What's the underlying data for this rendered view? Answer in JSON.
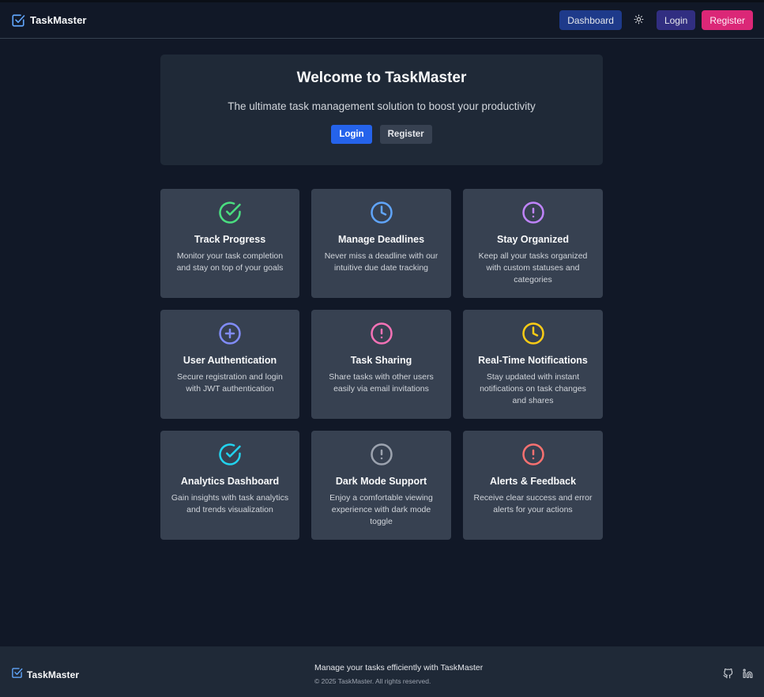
{
  "navbar": {
    "brand": "TaskMaster",
    "dashboard_label": "Dashboard",
    "login_label": "Login",
    "register_label": "Register",
    "theme_icon": "sun-icon"
  },
  "hero": {
    "title": "Welcome to TaskMaster",
    "subtitle": "The ultimate task management solution to boost your productivity",
    "login_label": "Login",
    "register_label": "Register"
  },
  "features": [
    {
      "title": "Track Progress",
      "description": "Monitor your task completion and stay on top of your goals",
      "icon": "check-circle-icon",
      "color": "#4ade80"
    },
    {
      "title": "Manage Deadlines",
      "description": "Never miss a deadline with our intuitive due date tracking",
      "icon": "clock-icon",
      "color": "#60a5fa"
    },
    {
      "title": "Stay Organized",
      "description": "Keep all your tasks organized with custom statuses and categories",
      "icon": "alert-circle-icon",
      "color": "#c084fc"
    },
    {
      "title": "User Authentication",
      "description": "Secure registration and login with JWT authentication",
      "icon": "plus-circle-icon",
      "color": "#818cf8"
    },
    {
      "title": "Task Sharing",
      "description": "Share tasks with other users easily via email invitations",
      "icon": "alert-circle-icon",
      "color": "#f472b6"
    },
    {
      "title": "Real-Time Notifications",
      "description": "Stay updated with instant notifications on task changes and shares",
      "icon": "clock-icon",
      "color": "#facc15"
    },
    {
      "title": "Analytics Dashboard",
      "description": "Gain insights with task analytics and trends visualization",
      "icon": "check-circle-icon",
      "color": "#22d3ee"
    },
    {
      "title": "Dark Mode Support",
      "description": "Enjoy a comfortable viewing experience with dark mode toggle",
      "icon": "alert-circle-icon",
      "color": "#9ca3af"
    },
    {
      "title": "Alerts & Feedback",
      "description": "Receive clear success and error alerts for your actions",
      "icon": "alert-circle-icon",
      "color": "#f87171"
    }
  ],
  "footer": {
    "brand": "TaskMaster",
    "tagline": "Manage your tasks efficiently with TaskMaster",
    "copyright": "© 2025 TaskMaster. All rights reserved.",
    "social": [
      "github-icon",
      "linkedin-icon"
    ]
  },
  "colors": {
    "background": "#111827",
    "panel": "#1f2937",
    "card": "#374151",
    "brand_accent": "#60a5fa",
    "primary_button": "#2563eb",
    "register_button": "#db2777"
  }
}
